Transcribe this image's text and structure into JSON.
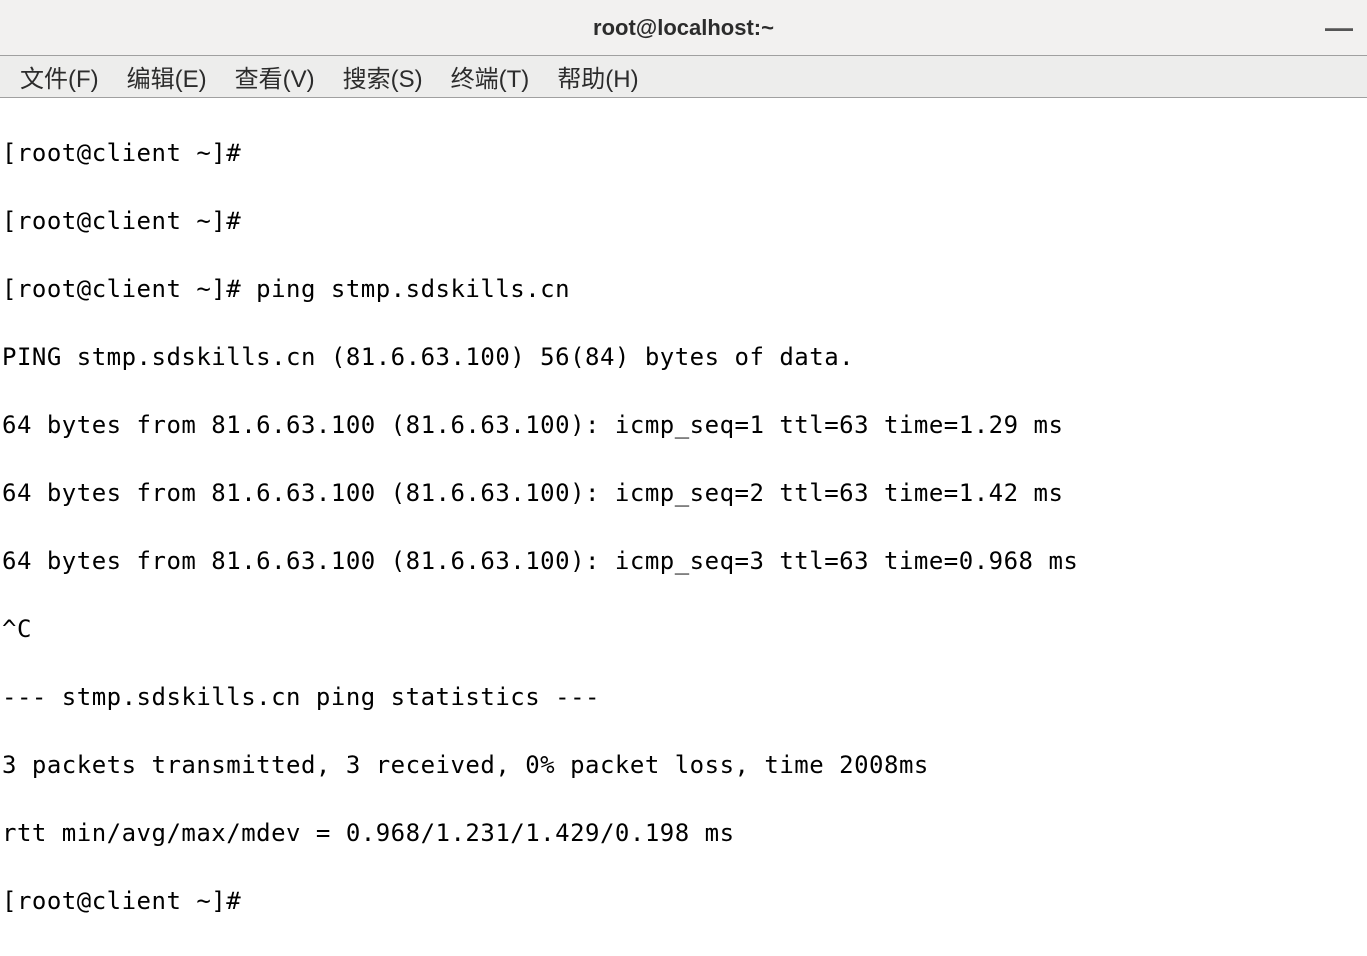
{
  "titlebar": {
    "title": "root@localhost:~"
  },
  "menu": {
    "file": "文件(F)",
    "edit": "编辑(E)",
    "view": "查看(V)",
    "search": "搜索(S)",
    "terminal": "终端(T)",
    "help": "帮助(H)"
  },
  "terminal": {
    "lines": [
      "[root@client ~]#",
      "[root@client ~]#",
      "[root@client ~]# ping stmp.sdskills.cn",
      "PING stmp.sdskills.cn (81.6.63.100) 56(84) bytes of data.",
      "64 bytes from 81.6.63.100 (81.6.63.100): icmp_seq=1 ttl=63 time=1.29 ms",
      "64 bytes from 81.6.63.100 (81.6.63.100): icmp_seq=2 ttl=63 time=1.42 ms",
      "64 bytes from 81.6.63.100 (81.6.63.100): icmp_seq=3 ttl=63 time=0.968 ms",
      "^C",
      "--- stmp.sdskills.cn ping statistics ---",
      "3 packets transmitted, 3 received, 0% packet loss, time 2008ms",
      "rtt min/avg/max/mdev = 0.968/1.231/1.429/0.198 ms",
      "[root@client ~]#"
    ]
  }
}
